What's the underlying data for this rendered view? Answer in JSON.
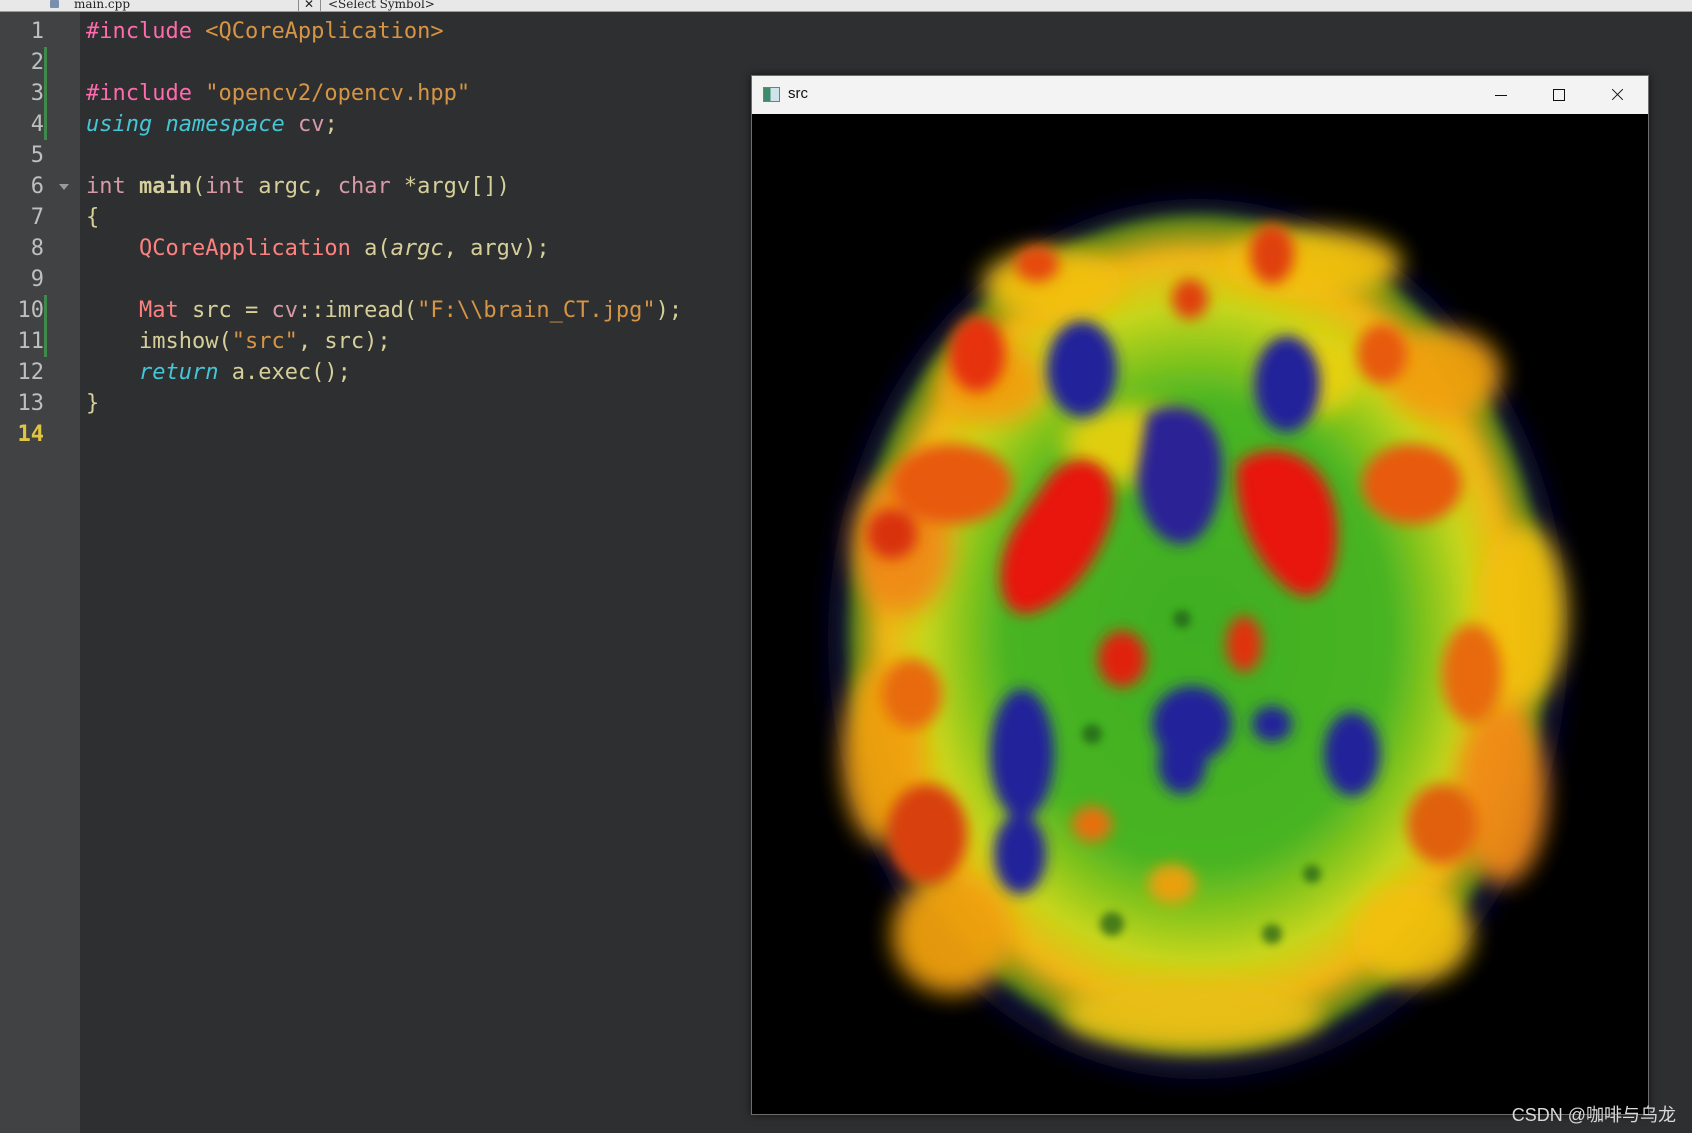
{
  "editor": {
    "file_tab": "main.cpp",
    "symbol_selector": "<Select Symbol>",
    "current_line": 14,
    "line_numbers": [
      "1",
      "2",
      "3",
      "4",
      "5",
      "6",
      "7",
      "8",
      "9",
      "10",
      "11",
      "12",
      "13",
      "14"
    ]
  },
  "code": {
    "l1": {
      "a": "#include",
      "b": " <QCoreApplication>"
    },
    "l3": {
      "a": "#include",
      "b": " \"opencv2/opencv.hpp\""
    },
    "l4": {
      "a": "using",
      "b": " ",
      "c": "namespace",
      "d": " cv",
      "e": ";"
    },
    "l6": {
      "a": "int",
      "b": " ",
      "c": "main",
      "d": "(",
      "e": "int",
      "f": " argc, ",
      "g": "char",
      "h": " *argv[])"
    },
    "l7": {
      "a": "{"
    },
    "l8": {
      "a": "    ",
      "b": "QCoreApplication",
      "c": " a(",
      "d": "argc",
      "e": ", argv);"
    },
    "l10": {
      "a": "    ",
      "b": "Mat",
      "c": " src = ",
      "d": "cv",
      "e": "::imread(",
      "f": "\"F:\\\\brain_CT.jpg\"",
      "g": ");"
    },
    "l11": {
      "a": "    imshow(",
      "b": "\"src\"",
      "c": ", src);"
    },
    "l12": {
      "a": "    ",
      "b": "return",
      "c": " a.exec();"
    },
    "l13": {
      "a": "}"
    }
  },
  "image_window": {
    "title": "src",
    "icon": "opencv-window-icon",
    "controls": [
      "minimize-icon",
      "maximize-icon",
      "close-icon"
    ],
    "content": "pseudo-color brain scan image"
  },
  "watermark": "CSDN @咖啡与乌龙",
  "colors": {
    "editor_bg": "#2e2f30",
    "gutter_bg": "#404244",
    "preprocessor": "#ff6aad",
    "string": "#d69545",
    "keyword": "#45c6d6",
    "current_line_number": "#e1c542"
  }
}
